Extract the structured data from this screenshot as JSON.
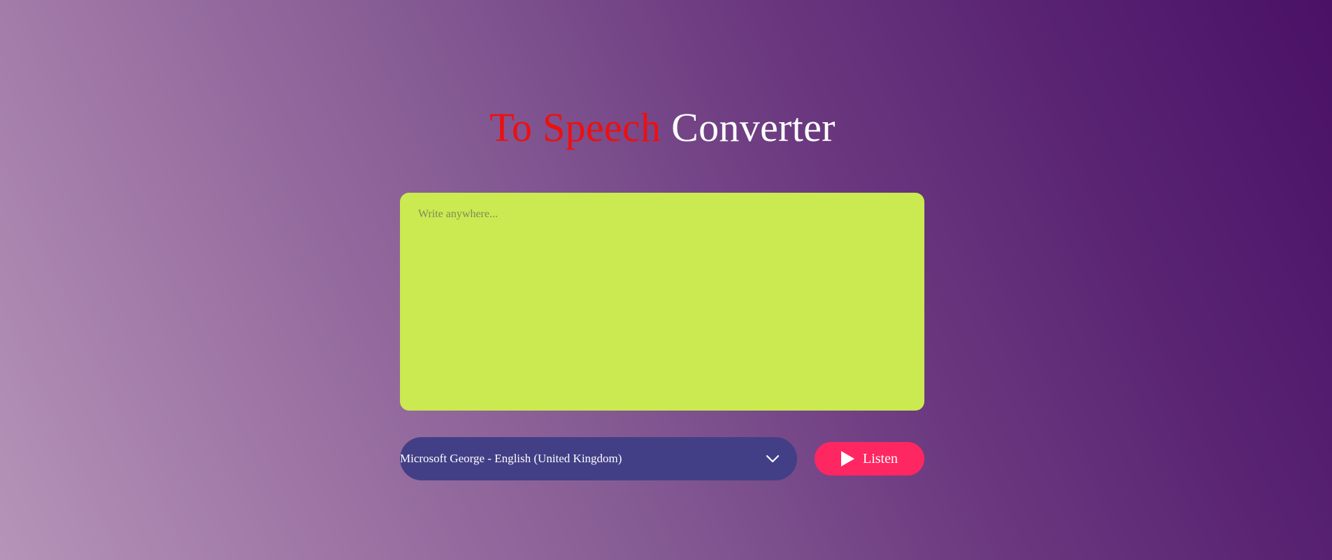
{
  "header": {
    "title_accent": "To Speech",
    "title_rest": "Converter"
  },
  "editor": {
    "placeholder": "Write anywhere...",
    "value": ""
  },
  "voice": {
    "selected": "Microsoft George - English (United Kingdom)",
    "icon": "chevron-down-icon"
  },
  "actions": {
    "listen_label": "Listen",
    "listen_icon": "play-icon"
  },
  "colors": {
    "title_accent": "#ee0f0f",
    "textarea_bg": "#cbe950",
    "select_bg": "#433f87",
    "button_bg": "#ff2762",
    "text_light": "#ffffff"
  }
}
